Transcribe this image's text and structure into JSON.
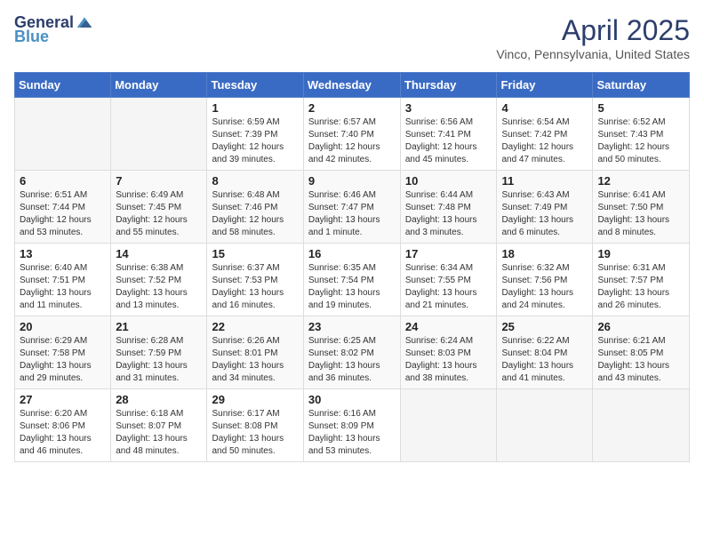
{
  "header": {
    "logo": {
      "general": "General",
      "blue": "Blue"
    },
    "title": "April 2025",
    "location": "Vinco, Pennsylvania, United States"
  },
  "calendar": {
    "days_of_week": [
      "Sunday",
      "Monday",
      "Tuesday",
      "Wednesday",
      "Thursday",
      "Friday",
      "Saturday"
    ],
    "weeks": [
      [
        {
          "day": "",
          "info": ""
        },
        {
          "day": "",
          "info": ""
        },
        {
          "day": "1",
          "info": "Sunrise: 6:59 AM\nSunset: 7:39 PM\nDaylight: 12 hours and 39 minutes."
        },
        {
          "day": "2",
          "info": "Sunrise: 6:57 AM\nSunset: 7:40 PM\nDaylight: 12 hours and 42 minutes."
        },
        {
          "day": "3",
          "info": "Sunrise: 6:56 AM\nSunset: 7:41 PM\nDaylight: 12 hours and 45 minutes."
        },
        {
          "day": "4",
          "info": "Sunrise: 6:54 AM\nSunset: 7:42 PM\nDaylight: 12 hours and 47 minutes."
        },
        {
          "day": "5",
          "info": "Sunrise: 6:52 AM\nSunset: 7:43 PM\nDaylight: 12 hours and 50 minutes."
        }
      ],
      [
        {
          "day": "6",
          "info": "Sunrise: 6:51 AM\nSunset: 7:44 PM\nDaylight: 12 hours and 53 minutes."
        },
        {
          "day": "7",
          "info": "Sunrise: 6:49 AM\nSunset: 7:45 PM\nDaylight: 12 hours and 55 minutes."
        },
        {
          "day": "8",
          "info": "Sunrise: 6:48 AM\nSunset: 7:46 PM\nDaylight: 12 hours and 58 minutes."
        },
        {
          "day": "9",
          "info": "Sunrise: 6:46 AM\nSunset: 7:47 PM\nDaylight: 13 hours and 1 minute."
        },
        {
          "day": "10",
          "info": "Sunrise: 6:44 AM\nSunset: 7:48 PM\nDaylight: 13 hours and 3 minutes."
        },
        {
          "day": "11",
          "info": "Sunrise: 6:43 AM\nSunset: 7:49 PM\nDaylight: 13 hours and 6 minutes."
        },
        {
          "day": "12",
          "info": "Sunrise: 6:41 AM\nSunset: 7:50 PM\nDaylight: 13 hours and 8 minutes."
        }
      ],
      [
        {
          "day": "13",
          "info": "Sunrise: 6:40 AM\nSunset: 7:51 PM\nDaylight: 13 hours and 11 minutes."
        },
        {
          "day": "14",
          "info": "Sunrise: 6:38 AM\nSunset: 7:52 PM\nDaylight: 13 hours and 13 minutes."
        },
        {
          "day": "15",
          "info": "Sunrise: 6:37 AM\nSunset: 7:53 PM\nDaylight: 13 hours and 16 minutes."
        },
        {
          "day": "16",
          "info": "Sunrise: 6:35 AM\nSunset: 7:54 PM\nDaylight: 13 hours and 19 minutes."
        },
        {
          "day": "17",
          "info": "Sunrise: 6:34 AM\nSunset: 7:55 PM\nDaylight: 13 hours and 21 minutes."
        },
        {
          "day": "18",
          "info": "Sunrise: 6:32 AM\nSunset: 7:56 PM\nDaylight: 13 hours and 24 minutes."
        },
        {
          "day": "19",
          "info": "Sunrise: 6:31 AM\nSunset: 7:57 PM\nDaylight: 13 hours and 26 minutes."
        }
      ],
      [
        {
          "day": "20",
          "info": "Sunrise: 6:29 AM\nSunset: 7:58 PM\nDaylight: 13 hours and 29 minutes."
        },
        {
          "day": "21",
          "info": "Sunrise: 6:28 AM\nSunset: 7:59 PM\nDaylight: 13 hours and 31 minutes."
        },
        {
          "day": "22",
          "info": "Sunrise: 6:26 AM\nSunset: 8:01 PM\nDaylight: 13 hours and 34 minutes."
        },
        {
          "day": "23",
          "info": "Sunrise: 6:25 AM\nSunset: 8:02 PM\nDaylight: 13 hours and 36 minutes."
        },
        {
          "day": "24",
          "info": "Sunrise: 6:24 AM\nSunset: 8:03 PM\nDaylight: 13 hours and 38 minutes."
        },
        {
          "day": "25",
          "info": "Sunrise: 6:22 AM\nSunset: 8:04 PM\nDaylight: 13 hours and 41 minutes."
        },
        {
          "day": "26",
          "info": "Sunrise: 6:21 AM\nSunset: 8:05 PM\nDaylight: 13 hours and 43 minutes."
        }
      ],
      [
        {
          "day": "27",
          "info": "Sunrise: 6:20 AM\nSunset: 8:06 PM\nDaylight: 13 hours and 46 minutes."
        },
        {
          "day": "28",
          "info": "Sunrise: 6:18 AM\nSunset: 8:07 PM\nDaylight: 13 hours and 48 minutes."
        },
        {
          "day": "29",
          "info": "Sunrise: 6:17 AM\nSunset: 8:08 PM\nDaylight: 13 hours and 50 minutes."
        },
        {
          "day": "30",
          "info": "Sunrise: 6:16 AM\nSunset: 8:09 PM\nDaylight: 13 hours and 53 minutes."
        },
        {
          "day": "",
          "info": ""
        },
        {
          "day": "",
          "info": ""
        },
        {
          "day": "",
          "info": ""
        }
      ]
    ]
  }
}
